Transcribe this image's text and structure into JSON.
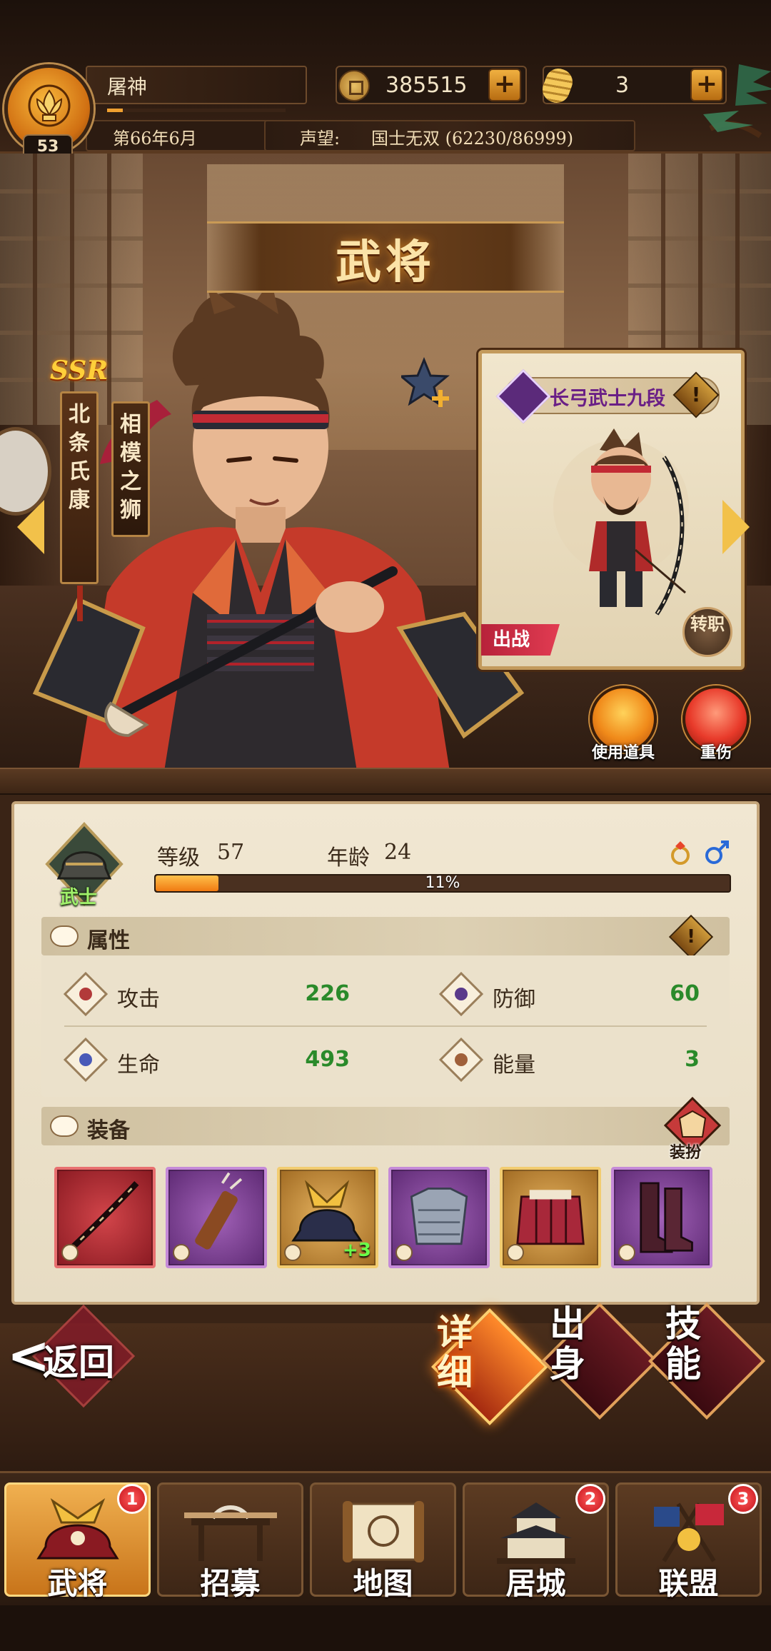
{
  "player": {
    "name": "屠神",
    "level": "53",
    "date": "第66年6月",
    "fame_label": "声望:",
    "fame_value": "国士无双 (62230/86999)"
  },
  "resources": {
    "coins": "385515",
    "rice": "3",
    "plus": "+"
  },
  "page_title": "武将",
  "hero": {
    "rarity": "SSR",
    "name": "北条氏康",
    "title": "相模之狮",
    "class_name": "长弓武士九段",
    "class_info": "!",
    "deploy_tag": "出战",
    "transfer_label": "转职",
    "class_tag": "武士"
  },
  "actions": {
    "use_item": "使用道具",
    "heal": "重伤"
  },
  "stats": {
    "level_label": "等级",
    "level_value": "57",
    "age_label": "年龄",
    "age_value": "24",
    "progress_text": "11%",
    "progress": 0.11
  },
  "attributes": {
    "header": "属性",
    "info": "!",
    "items": [
      {
        "name": "攻击",
        "value": "226",
        "color": "#b23a3a"
      },
      {
        "name": "防御",
        "value": "60",
        "color": "#5a3a8a"
      },
      {
        "name": "生命",
        "value": "493",
        "color": "#4a5ab8"
      },
      {
        "name": "能量",
        "value": "3",
        "color": "#a0603a"
      }
    ]
  },
  "equipment": {
    "header": "装备",
    "outfit_label": "装扮",
    "enhance_label": "+3",
    "items": [
      {
        "name": "longbow",
        "rarity": "red"
      },
      {
        "name": "quiver",
        "rarity": "purple"
      },
      {
        "name": "helmet",
        "rarity": "gold"
      },
      {
        "name": "armor",
        "rarity": "purple"
      },
      {
        "name": "skirt-armor",
        "rarity": "gold"
      },
      {
        "name": "boots",
        "rarity": "purple"
      }
    ]
  },
  "bottom_tabs": {
    "back": "返回",
    "back_arrow": "<",
    "detail": "详细",
    "origin": "出身",
    "skill": "技能"
  },
  "nav": [
    {
      "label": "武将",
      "badge": "1"
    },
    {
      "label": "招募",
      "badge": ""
    },
    {
      "label": "地图",
      "badge": ""
    },
    {
      "label": "居城",
      "badge": "2"
    },
    {
      "label": "联盟",
      "badge": "3"
    }
  ]
}
